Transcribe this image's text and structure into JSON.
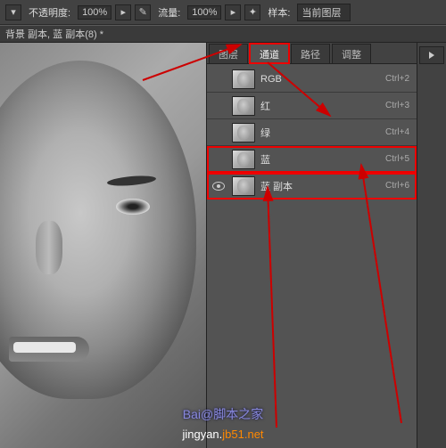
{
  "topbar": {
    "opacity_label": "不透明度:",
    "opacity_value": "100%",
    "flow_label": "流量:",
    "flow_value": "100%",
    "sample_label": "样本:",
    "sample_value": "当前图层"
  },
  "layerbar": {
    "doc_title": "背景 副本, 蓝 副本(8) *"
  },
  "tabs": {
    "layers": "图层",
    "channels": "通道",
    "paths": "路径",
    "adjust": "调整"
  },
  "channels": [
    {
      "name": "RGB",
      "shortcut": "Ctrl+2",
      "visible": false,
      "hl": false
    },
    {
      "name": "红",
      "shortcut": "Ctrl+3",
      "visible": false,
      "hl": false
    },
    {
      "name": "绿",
      "shortcut": "Ctrl+4",
      "visible": false,
      "hl": false
    },
    {
      "name": "蓝",
      "shortcut": "Ctrl+5",
      "visible": false,
      "hl": true
    },
    {
      "name": "蓝 副本",
      "shortcut": "Ctrl+6",
      "visible": true,
      "hl": true
    }
  ],
  "watermarks": {
    "w1": "Bai@脚本之家",
    "w2_a": "jingyan.",
    "w2_b": "jb51.net"
  }
}
